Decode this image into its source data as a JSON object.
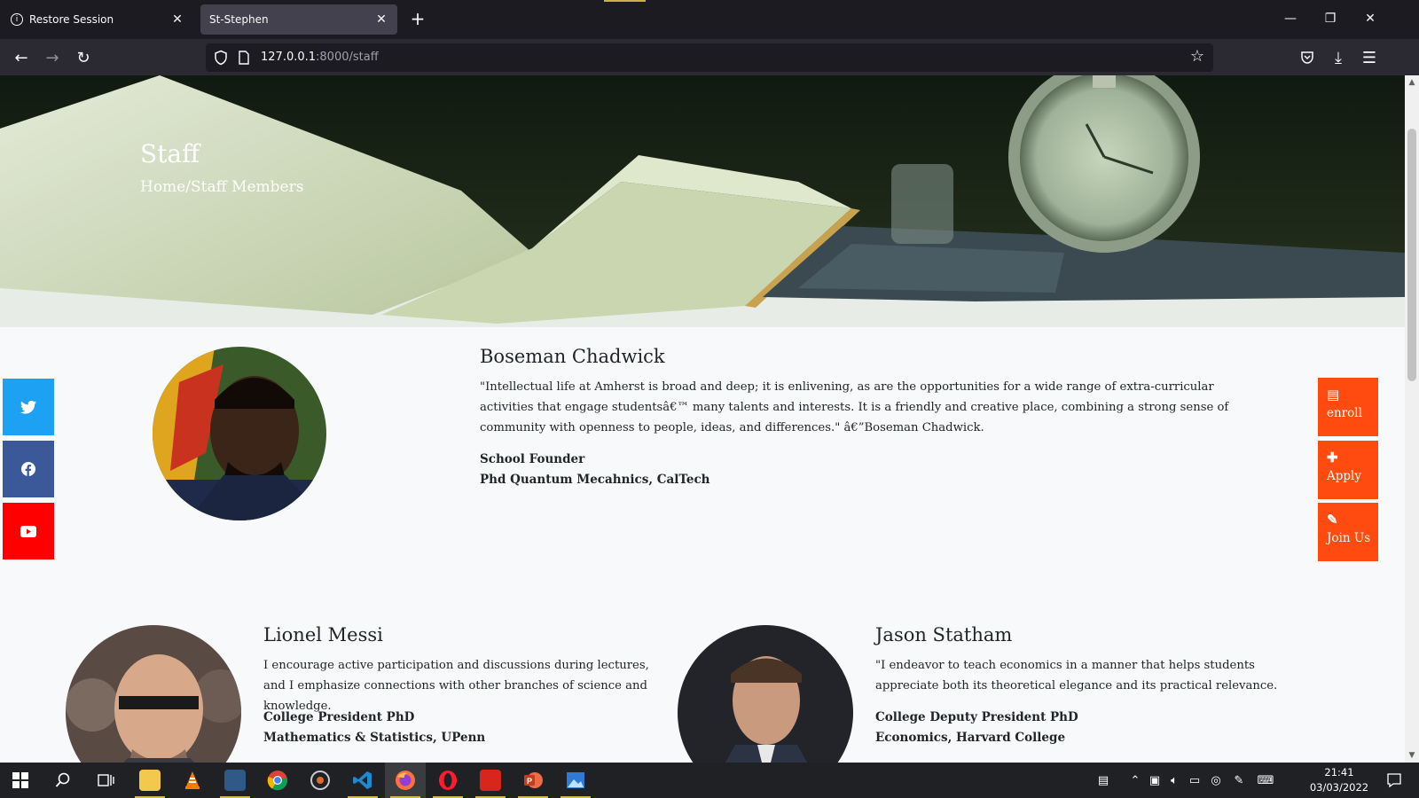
{
  "browser": {
    "tabs": [
      {
        "label": "Restore Session",
        "active": false
      },
      {
        "label": "St-Stephen",
        "active": true
      }
    ],
    "url_host": "127.0.0.1",
    "url_rest": ":8000/staff"
  },
  "hero": {
    "title": "Staff",
    "breadcrumb": "Home/Staff Members"
  },
  "staff": [
    {
      "name": "Boseman Chadwick",
      "quote": "\"Intellectual life at Amherst is broad and deep; it is enlivening, as are the opportunities for a wide range of extra-curricular activities that engage studentsâ€™ many talents and interests. It is a friendly and creative place, combining a strong sense of community with openness to people, ideas, and differences.\" â€”Boseman Chadwick.",
      "role": "School Founder",
      "credential": "Phd Quantum Mecahnics, CalTech"
    },
    {
      "name": "Lionel Messi",
      "quote": "I encourage active participation and discussions during lectures, and I emphasize connections with other branches of science and knowledge.",
      "role": "College President PhD",
      "credential": "Mathematics & Statistics, UPenn"
    },
    {
      "name": "Jason Statham",
      "quote": "\"I endeavor to teach economics in a manner that helps students appreciate both its theoretical elegance and its practical relevance.",
      "role": "College Deputy President PhD",
      "credential": "Economics, Harvard College"
    }
  ],
  "social": [
    {
      "icon": "twitter-icon",
      "color": "#1da1f2"
    },
    {
      "icon": "facebook-icon",
      "color": "#3b5998"
    },
    {
      "icon": "youtube-icon",
      "color": "#ff0000"
    }
  ],
  "actions": [
    {
      "label": "enroll",
      "icon": "document-icon"
    },
    {
      "label": "Apply",
      "icon": "plus-icon"
    },
    {
      "label": "Join Us",
      "icon": "edit-icon"
    }
  ],
  "accent_color": "#ff4b0f",
  "taskbar": {
    "time": "21:41",
    "date": "03/03/2022"
  }
}
